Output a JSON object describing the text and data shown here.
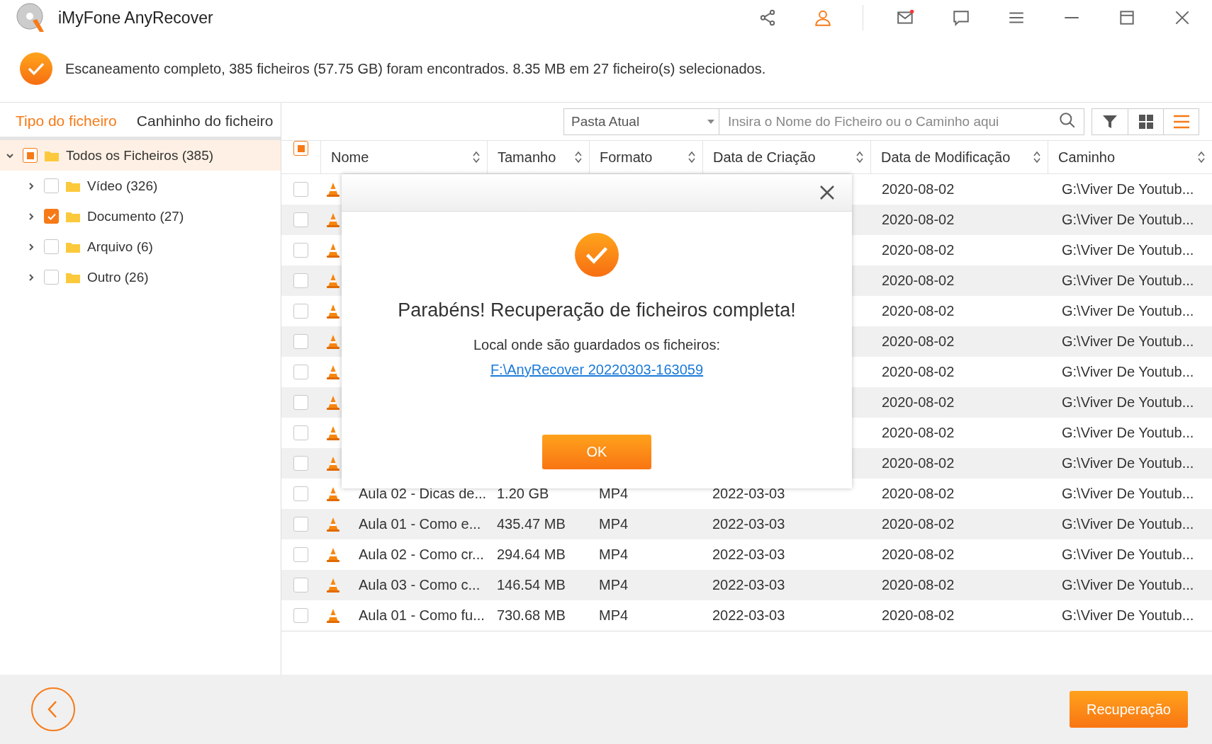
{
  "app": {
    "title": "iMyFone AnyRecover"
  },
  "status": {
    "message": "Escaneamento completo, 385 ficheiros (57.75 GB) foram encontrados. 8.35 MB em 27 ficheiro(s) selecionados."
  },
  "tabs": [
    {
      "label": "Tipo do ficheiro",
      "selected": true
    },
    {
      "label": "Canhinho do ficheiro",
      "selected": false
    }
  ],
  "tree": [
    {
      "label": "Todos os Ficheiros (385)",
      "checked": true,
      "partial": true,
      "expanded": true,
      "selected": true,
      "children": [
        {
          "label": "Vídeo (326)",
          "checked": false,
          "expanded": false,
          "selected": false
        },
        {
          "label": "Documento (27)",
          "checked": true,
          "expanded": false,
          "selected": false
        },
        {
          "label": "Arquivo (6)",
          "checked": false,
          "expanded": false,
          "selected": false
        },
        {
          "label": "Outro (26)",
          "checked": false,
          "expanded": false,
          "selected": false
        }
      ]
    }
  ],
  "toolbar": {
    "scope": "Pasta Atual",
    "search_placeholder": "Insira o Nome do Ficheiro ou o Caminho aqui",
    "views": [
      {
        "kind": "grid",
        "selected": false
      },
      {
        "kind": "list",
        "selected": true
      }
    ]
  },
  "table": {
    "select_all": {
      "checked": true,
      "partial": true
    },
    "columns": [
      "Nome",
      "Tamanho",
      "Formato",
      "Data de Criação",
      "Data de Modificação",
      "Caminho"
    ],
    "rows": [
      {
        "checked": false,
        "modified": "2020-08-02",
        "path": "G:\\Viver De Youtub..."
      },
      {
        "checked": false,
        "modified": "2020-08-02",
        "path": "G:\\Viver De Youtub..."
      },
      {
        "checked": false,
        "modified": "2020-08-02",
        "path": "G:\\Viver De Youtub..."
      },
      {
        "checked": false,
        "modified": "2020-08-02",
        "path": "G:\\Viver De Youtub..."
      },
      {
        "checked": false,
        "modified": "2020-08-02",
        "path": "G:\\Viver De Youtub..."
      },
      {
        "checked": false,
        "modified": "2020-08-02",
        "path": "G:\\Viver De Youtub..."
      },
      {
        "checked": false,
        "modified": "2020-08-02",
        "path": "G:\\Viver De Youtub..."
      },
      {
        "checked": false,
        "modified": "2020-08-02",
        "path": "G:\\Viver De Youtub..."
      },
      {
        "checked": false,
        "modified": "2020-08-02",
        "path": "G:\\Viver De Youtub..."
      },
      {
        "checked": false,
        "modified": "2020-08-02",
        "path": "G:\\Viver De Youtub..."
      },
      {
        "checked": false,
        "name": "Aula 02 - Dicas de...",
        "size": "1.20 GB",
        "format": "MP4",
        "created": "2022-03-03",
        "modified": "2020-08-02",
        "path": "G:\\Viver De Youtub..."
      },
      {
        "checked": false,
        "name": "Aula 01 - Como e...",
        "size": "435.47 MB",
        "format": "MP4",
        "created": "2022-03-03",
        "modified": "2020-08-02",
        "path": "G:\\Viver De Youtub..."
      },
      {
        "checked": false,
        "name": "Aula 02 - Como cr...",
        "size": "294.64 MB",
        "format": "MP4",
        "created": "2022-03-03",
        "modified": "2020-08-02",
        "path": "G:\\Viver De Youtub..."
      },
      {
        "checked": false,
        "name": "Aula 03 - Como c...",
        "size": "146.54 MB",
        "format": "MP4",
        "created": "2022-03-03",
        "modified": "2020-08-02",
        "path": "G:\\Viver De Youtub..."
      },
      {
        "checked": false,
        "name": "Aula 01 - Como fu...",
        "size": "730.68 MB",
        "format": "MP4",
        "created": "2022-03-03",
        "modified": "2020-08-02",
        "path": "G:\\Viver De Youtub..."
      }
    ]
  },
  "dialog": {
    "title": "Parabéns! Recuperação de ficheiros completa!",
    "label": "Local onde são guardados os ficheiros:",
    "link": "F:\\AnyRecover 20220303-163059",
    "button": "OK"
  },
  "footer": {
    "button": "Recuperação"
  }
}
